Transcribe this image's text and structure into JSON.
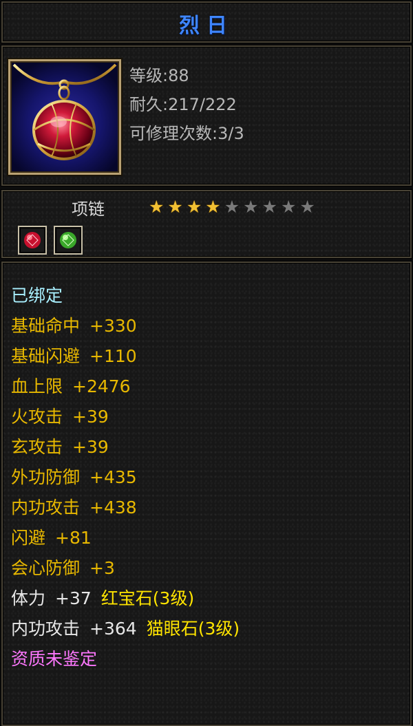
{
  "item": {
    "name": "烈日",
    "type": "项链",
    "stars_total": 9,
    "stars_filled": 4
  },
  "info": {
    "level": "等级:88",
    "durability": "耐久:217/222",
    "repairs": "可修理次数:3/3"
  },
  "attributes": {
    "bound": "已绑定",
    "rows": [
      {
        "name": "基础命中",
        "value": "+330"
      },
      {
        "name": "基础闪避",
        "value": "+110"
      },
      {
        "name": "血上限",
        "value": "+2476"
      },
      {
        "name": "火攻击",
        "value": "+39"
      },
      {
        "name": "玄攻击",
        "value": "+39"
      },
      {
        "name": "外功防御",
        "value": "+435"
      },
      {
        "name": "内功攻击",
        "value": "+438"
      },
      {
        "name": "闪避",
        "value": "+81"
      },
      {
        "name": "会心防御",
        "value": "+3"
      }
    ],
    "gems": [
      {
        "name": "体力",
        "value": "+37",
        "gem": "红宝石(3级)"
      },
      {
        "name": "内功攻击",
        "value": "+364",
        "gem": "猫眼石(3级)"
      }
    ],
    "aptitude": "资质未鉴定"
  },
  "colors": {
    "title": "#3f86ff",
    "bound": "#a9f0ff",
    "attribute": "#e8b800",
    "gem_attribute": "#e7e7e7",
    "gem_name": "#ffe400",
    "aptitude": "#ff78ff",
    "star_on": "#f2c032",
    "star_off": "#7a7a7a"
  },
  "icons": {
    "item": "ruby-pendant-necklace-icon",
    "gem_slot_1": "red-gem-icon",
    "gem_slot_2": "green-gem-icon"
  }
}
